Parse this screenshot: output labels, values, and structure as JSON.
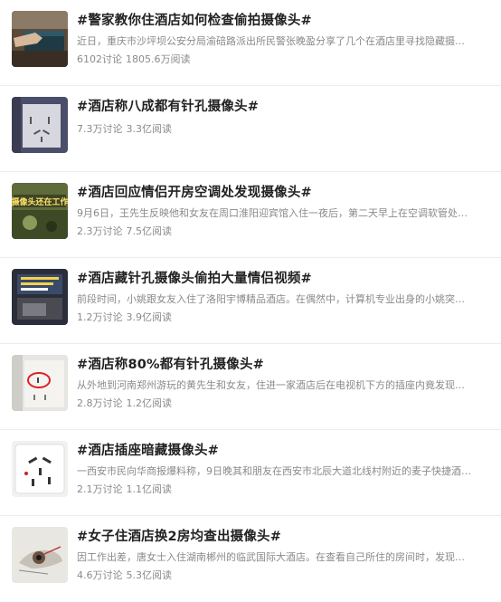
{
  "topics": [
    {
      "title": "#警家教你住酒店如何检查偷拍摄像头#",
      "summary": "近日，重庆市沙坪坝公安分局渝碚路派出所民警张晚盈分享了几个在酒店里寻找隐藏摄像头...",
      "discussions": "6102讨论",
      "reads": "1805.6万阅读",
      "thumb_icon": "hand-on-box-photo"
    },
    {
      "title": "#酒店称八成都有针孔摄像头#",
      "summary": "",
      "discussions": "7.3万讨论",
      "reads": "3.3亿阅读",
      "thumb_icon": "wall-socket-photo"
    },
    {
      "title": "#酒店回应情侣开房空调处发现摄像头#",
      "summary": "9月6日，王先生反映他和女友在周口淮阳迎宾馆入住一夜后，第二天早上在空调软管处发...",
      "discussions": "2.3万讨论",
      "reads": "7.5亿阅读",
      "thumb_icon": "camera-in-aircon-photo",
      "thumb_caption": "摄像头还在工作"
    },
    {
      "title": "#酒店藏针孔摄像头偷拍大量情侣视频#",
      "summary": "前段时间，小姚跟女友入住了洛阳宇博精品酒店。在偶然中，计算机专业出身的小姚突然发...",
      "discussions": "1.2万讨论",
      "reads": "3.9亿阅读",
      "thumb_icon": "news-screen-photo"
    },
    {
      "title": "#酒店称80%都有针孔摄像头#",
      "summary": "从外地到河南郑州游玩的黄先生和女友，住进一家酒店后在电视机下方的插座内竟发现针孔...",
      "discussions": "2.8万讨论",
      "reads": "1.2亿阅读",
      "thumb_icon": "socket-red-circle-photo"
    },
    {
      "title": "#酒店插座暗藏摄像头#",
      "summary": "一西安市民向华商报爆料称，9日晚其和朋友在西安市北辰大道北线村附近的麦子快捷酒店...",
      "discussions": "2.1万讨论",
      "reads": "1.1亿阅读",
      "thumb_icon": "white-socket-photo"
    },
    {
      "title": "#女子住酒店换2房均查出摄像头#",
      "summary": "因工作出差，唐女士入住湖南郴州的临武国际大酒店。在查看自己所住的房间时，发现有针...",
      "discussions": "4.6万讨论",
      "reads": "5.3亿阅读",
      "thumb_icon": "hidden-camera-device-photo"
    }
  ]
}
